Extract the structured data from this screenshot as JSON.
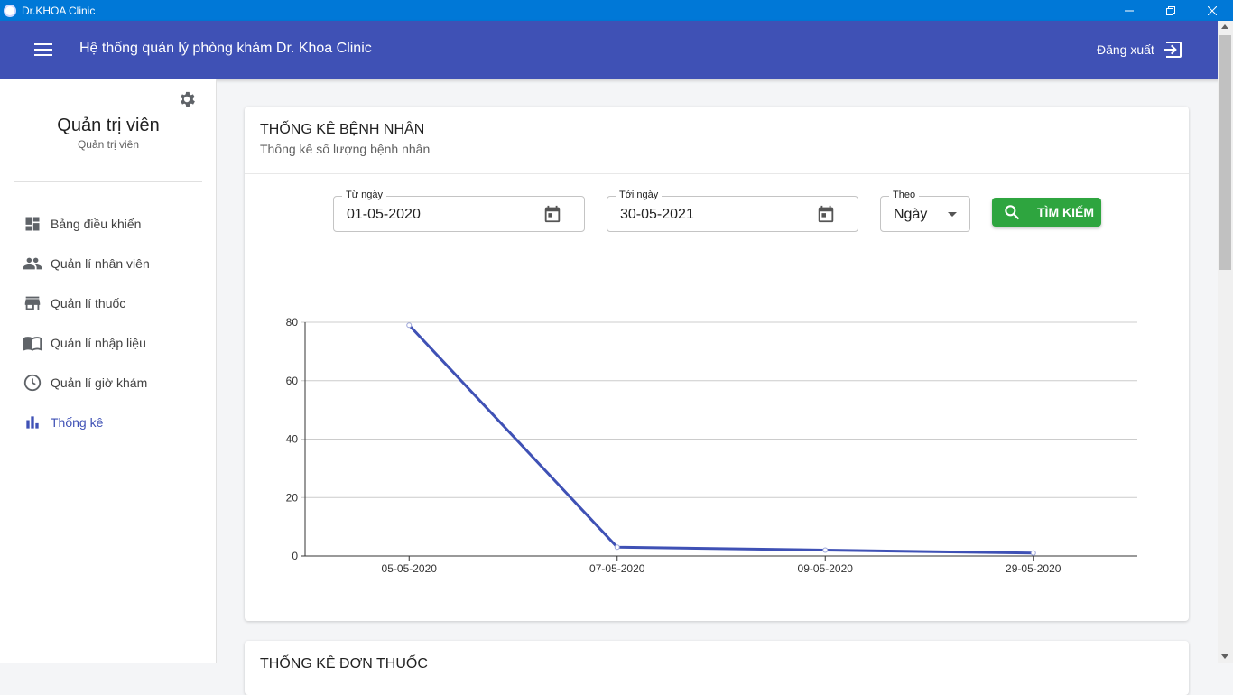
{
  "window": {
    "title": "Dr.KHOA Clinic"
  },
  "appbar": {
    "title": "Hệ thống quản lý phòng khám Dr. Khoa Clinic",
    "logout_label": "Đăng xuất"
  },
  "colors": {
    "primary": "#3f51b5",
    "titlebar": "#0078d7",
    "search_button": "#2ea53f",
    "line": "#3f51b5"
  },
  "sidebar": {
    "profile_name": "Quản trị viên",
    "profile_role": "Quản trị viên",
    "items": [
      {
        "label": "Bảng điều khiển",
        "icon": "dashboard-icon"
      },
      {
        "label": "Quản lí nhân viên",
        "icon": "people-icon"
      },
      {
        "label": "Quản lí thuốc",
        "icon": "store-icon"
      },
      {
        "label": "Quản lí nhập liệu",
        "icon": "book-icon"
      },
      {
        "label": "Quản lí giờ khám",
        "icon": "clock-icon"
      },
      {
        "label": "Thống kê",
        "icon": "bar-chart-icon",
        "active": true
      }
    ]
  },
  "card": {
    "title": "THỐNG KÊ BỆNH NHÂN",
    "subtitle": "Thống kê số lượng bệnh nhân",
    "from": {
      "label": "Từ ngày",
      "value": "01-05-2020"
    },
    "to": {
      "label": "Tới ngày",
      "value": "30-05-2021"
    },
    "by": {
      "label": "Theo",
      "value": "Ngày"
    },
    "search_label": "TÌM KIẾM"
  },
  "chart_data": {
    "type": "line",
    "categories": [
      "05-05-2020",
      "07-05-2020",
      "09-05-2020",
      "29-05-2020"
    ],
    "values": [
      79,
      3,
      2,
      1
    ],
    "ylim": [
      0,
      80
    ],
    "yticks": [
      0,
      20,
      40,
      60,
      80
    ],
    "grid": true
  },
  "card2": {
    "title": "THỐNG KÊ ĐƠN THUỐC"
  }
}
